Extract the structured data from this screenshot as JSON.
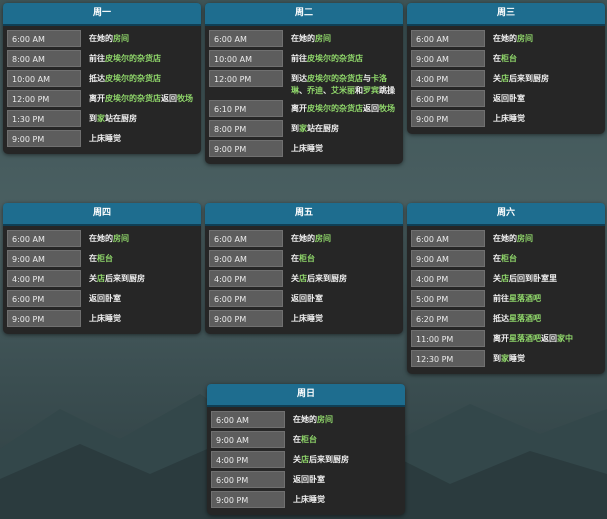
{
  "days": [
    {
      "name": "周一",
      "rows": [
        {
          "time": "6:00 AM",
          "event": [
            {
              "t": "在她的"
            },
            {
              "t": "房间",
              "hl": true
            }
          ]
        },
        {
          "time": "8:00 AM",
          "event": [
            {
              "t": "前往"
            },
            {
              "t": "皮埃尔的杂货店",
              "hl": true
            }
          ]
        },
        {
          "time": "10:00 AM",
          "event": [
            {
              "t": "抵达"
            },
            {
              "t": "皮埃尔的杂货店",
              "hl": true
            }
          ]
        },
        {
          "time": "12:00 PM",
          "event": [
            {
              "t": "离开"
            },
            {
              "t": "皮埃尔的杂货店",
              "hl": true
            },
            {
              "t": "返回"
            },
            {
              "t": "牧场",
              "hl": true
            }
          ]
        },
        {
          "time": "1:30 PM",
          "event": [
            {
              "t": "到"
            },
            {
              "t": "家",
              "hl": true
            },
            {
              "t": "站在厨房"
            }
          ]
        },
        {
          "time": "9:00 PM",
          "event": [
            {
              "t": "上床睡觉"
            }
          ]
        }
      ]
    },
    {
      "name": "周二",
      "rows": [
        {
          "time": "6:00 AM",
          "event": [
            {
              "t": "在她的"
            },
            {
              "t": "房间",
              "hl": true
            }
          ]
        },
        {
          "time": "10:00 AM",
          "event": [
            {
              "t": "前往"
            },
            {
              "t": "皮埃尔的杂货店",
              "hl": true
            }
          ]
        },
        {
          "time": "12:00 PM",
          "event": [
            {
              "t": "到达"
            },
            {
              "t": "皮埃尔的杂货店",
              "hl": true
            },
            {
              "t": "与"
            },
            {
              "t": "卡洛琳",
              "hl": true
            },
            {
              "t": "、"
            },
            {
              "t": "乔迪",
              "hl": true
            },
            {
              "t": "、"
            },
            {
              "t": "艾米丽",
              "hl": true
            },
            {
              "t": "和"
            },
            {
              "t": "罗宾",
              "hl": true
            },
            {
              "t": "跳操"
            }
          ]
        },
        {
          "time": "6:10 PM",
          "event": [
            {
              "t": "离开"
            },
            {
              "t": "皮埃尔的杂货店",
              "hl": true
            },
            {
              "t": "返回"
            },
            {
              "t": "牧场",
              "hl": true
            }
          ]
        },
        {
          "time": "8:00 PM",
          "event": [
            {
              "t": "到"
            },
            {
              "t": "家",
              "hl": true
            },
            {
              "t": "站在厨房"
            }
          ]
        },
        {
          "time": "9:00 PM",
          "event": [
            {
              "t": "上床睡觉"
            }
          ]
        }
      ]
    },
    {
      "name": "周三",
      "rows": [
        {
          "time": "6:00 AM",
          "event": [
            {
              "t": "在她的"
            },
            {
              "t": "房间",
              "hl": true
            }
          ]
        },
        {
          "time": "9:00 AM",
          "event": [
            {
              "t": "在"
            },
            {
              "t": "柜台",
              "hl": true
            }
          ]
        },
        {
          "time": "4:00 PM",
          "event": [
            {
              "t": "关"
            },
            {
              "t": "店",
              "hl": true
            },
            {
              "t": "后来到厨房"
            }
          ]
        },
        {
          "time": "6:00 PM",
          "event": [
            {
              "t": "返回卧室"
            }
          ]
        },
        {
          "time": "9:00 PM",
          "event": [
            {
              "t": "上床睡觉"
            }
          ]
        }
      ]
    },
    {
      "name": "周四",
      "rows": [
        {
          "time": "6:00 AM",
          "event": [
            {
              "t": "在她的"
            },
            {
              "t": "房间",
              "hl": true
            }
          ]
        },
        {
          "time": "9:00 AM",
          "event": [
            {
              "t": "在"
            },
            {
              "t": "柜台",
              "hl": true
            }
          ]
        },
        {
          "time": "4:00 PM",
          "event": [
            {
              "t": "关"
            },
            {
              "t": "店",
              "hl": true
            },
            {
              "t": "后来到厨房"
            }
          ]
        },
        {
          "time": "6:00 PM",
          "event": [
            {
              "t": "返回卧室"
            }
          ]
        },
        {
          "time": "9:00 PM",
          "event": [
            {
              "t": "上床睡觉"
            }
          ]
        }
      ]
    },
    {
      "name": "周五",
      "rows": [
        {
          "time": "6:00 AM",
          "event": [
            {
              "t": "在她的"
            },
            {
              "t": "房间",
              "hl": true
            }
          ]
        },
        {
          "time": "9:00 AM",
          "event": [
            {
              "t": "在"
            },
            {
              "t": "柜台",
              "hl": true
            }
          ]
        },
        {
          "time": "4:00 PM",
          "event": [
            {
              "t": "关"
            },
            {
              "t": "店",
              "hl": true
            },
            {
              "t": "后来到厨房"
            }
          ]
        },
        {
          "time": "6:00 PM",
          "event": [
            {
              "t": "返回卧室"
            }
          ]
        },
        {
          "time": "9:00 PM",
          "event": [
            {
              "t": "上床睡觉"
            }
          ]
        }
      ]
    },
    {
      "name": "周六",
      "rows": [
        {
          "time": "6:00 AM",
          "event": [
            {
              "t": "在她的"
            },
            {
              "t": "房间",
              "hl": true
            }
          ]
        },
        {
          "time": "9:00 AM",
          "event": [
            {
              "t": "在"
            },
            {
              "t": "柜台",
              "hl": true
            }
          ]
        },
        {
          "time": "4:00 PM",
          "event": [
            {
              "t": "关"
            },
            {
              "t": "店",
              "hl": true
            },
            {
              "t": "后回到卧室里"
            }
          ]
        },
        {
          "time": "5:00 PM",
          "event": [
            {
              "t": "前往"
            },
            {
              "t": "星落酒吧",
              "hl": true
            }
          ]
        },
        {
          "time": "6:20 PM",
          "event": [
            {
              "t": "抵达"
            },
            {
              "t": "星落酒吧",
              "hl": true
            }
          ]
        },
        {
          "time": "11:00 PM",
          "event": [
            {
              "t": "离开"
            },
            {
              "t": "星落酒吧",
              "hl": true
            },
            {
              "t": "返回"
            },
            {
              "t": "家中",
              "hl": true
            }
          ]
        },
        {
          "time": "12:30 PM",
          "event": [
            {
              "t": "到"
            },
            {
              "t": "家",
              "hl": true
            },
            {
              "t": "睡觉"
            }
          ]
        }
      ]
    },
    {
      "name": "周日",
      "rows": [
        {
          "time": "6:00 AM",
          "event": [
            {
              "t": "在她的"
            },
            {
              "t": "房间",
              "hl": true
            }
          ]
        },
        {
          "time": "9:00 AM",
          "event": [
            {
              "t": "在"
            },
            {
              "t": "柜台",
              "hl": true
            }
          ]
        },
        {
          "time": "4:00 PM",
          "event": [
            {
              "t": "关"
            },
            {
              "t": "店",
              "hl": true
            },
            {
              "t": "后来到厨房"
            }
          ]
        },
        {
          "time": "6:00 PM",
          "event": [
            {
              "t": "返回卧室"
            }
          ]
        },
        {
          "time": "9:00 PM",
          "event": [
            {
              "t": "上床睡觉"
            }
          ]
        }
      ]
    }
  ],
  "colors": {
    "header": "#1e6d8f",
    "highlight": "#8fd66a",
    "time_bg": "#5d5d5d",
    "card_bg": "#262626"
  }
}
